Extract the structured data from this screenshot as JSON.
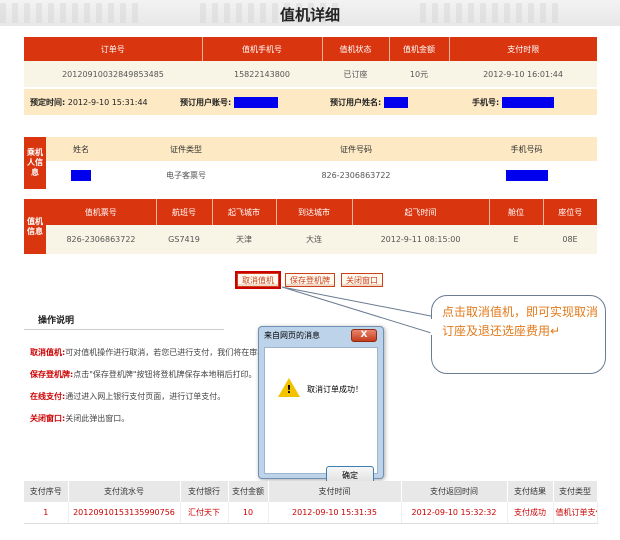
{
  "page": {
    "title": "值机详细"
  },
  "order": {
    "headers": [
      "订单号",
      "值机手机号",
      "值机状态",
      "值机金额",
      "支付时限"
    ],
    "values": [
      "20120910032849853485",
      "15822143800",
      "已订座",
      "10元",
      "2012-9-10 16:01:44"
    ],
    "meta": {
      "booking_time_label": "预定时间:",
      "booking_time_value": "2012-9-10 15:31:44",
      "account_label": "预订用户账号:",
      "name_label": "预订用户姓名:",
      "phone_label": "手机号:"
    }
  },
  "passenger": {
    "side_label": "乘机人信息",
    "headers": [
      "姓名",
      "证件类型",
      "证件号码",
      "手机号码"
    ],
    "values": [
      "",
      "电子客票号",
      "826-2306863722",
      ""
    ]
  },
  "flight": {
    "side_label": "值机信息",
    "headers": [
      "值机票号",
      "航班号",
      "起飞城市",
      "到达城市",
      "起飞时间",
      "舱位",
      "座位号"
    ],
    "values": [
      "826-2306863722",
      "GS7419",
      "天津",
      "大连",
      "2012-9-11 08:15:00",
      "E",
      "08E"
    ]
  },
  "actions": {
    "cancel": "取消值机",
    "save": "保存登机牌",
    "close": "关闭窗口"
  },
  "ops": {
    "title": "操作说明",
    "items": [
      {
        "key": "取消值机:",
        "text": "可对值机操作进行取消，若您已进行支付，我们将在审核通"
      },
      {
        "key": "保存登机牌:",
        "text": "点击\"保存登机牌\"按钮将登机牌保存本地稍后打印。"
      },
      {
        "key": "在线支付:",
        "text": "通过进入网上银行支付页面，进行订单支付。"
      },
      {
        "key": "关闭窗口:",
        "text": "关闭此弹出窗口。"
      }
    ]
  },
  "dialog": {
    "title": "来自网页的消息",
    "close": "X",
    "message": "取消订单成功！",
    "ok": "确定",
    "icon": "warning-icon"
  },
  "callout": {
    "text": "点击取消值机，即可实现取消订座及退还选座费用↵"
  },
  "payment": {
    "headers": [
      "支付序号",
      "支付流水号",
      "支付银行",
      "支付金额",
      "支付时间",
      "支付返回时间",
      "支付结果",
      "支付类型"
    ],
    "values": [
      "1",
      "20120910153135990756",
      "汇付天下",
      "10",
      "2012-09-10 15:31:35",
      "2012-09-10 15:32:32",
      "支付成功",
      "值机订单支付"
    ]
  },
  "colors": {
    "accent": "#d9350f",
    "callout_text": "#e2791a",
    "mask": "#0000ee"
  }
}
